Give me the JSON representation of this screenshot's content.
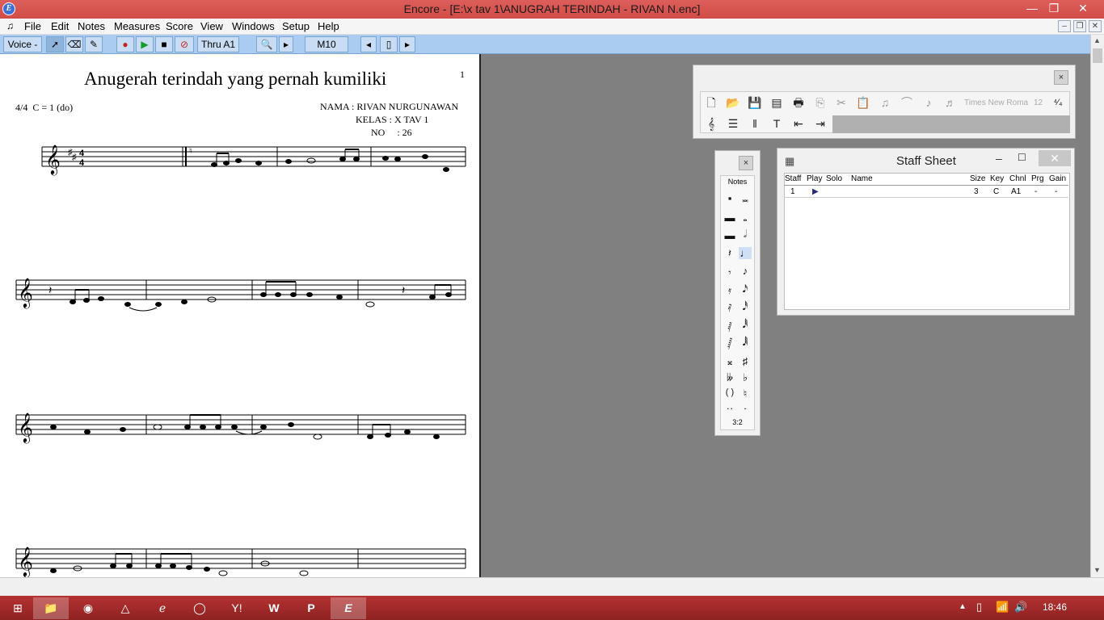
{
  "window": {
    "title": "Encore - [E:\\x tav 1\\ANUGRAH TERINDAH - RIVAN N.enc]",
    "minimize": "—",
    "restore": "❐",
    "close": "✕"
  },
  "menu": {
    "items": [
      "File",
      "Edit",
      "Notes",
      "Measures",
      "Score",
      "View",
      "Windows",
      "Setup",
      "Help"
    ],
    "mdi_min": "–",
    "mdi_restore": "❐",
    "mdi_close": "✕"
  },
  "toolbar": {
    "voice": "Voice -",
    "thru": "Thru A1",
    "measure": "M10"
  },
  "score": {
    "title": "Anugerah terindah yang pernah kumiliki",
    "page_number": "1",
    "meter": "4/4  C = 1 (do)",
    "name": "NAMA : RIVAN NURGUNAWAN",
    "class": "KELAS : X TAV 1",
    "number": "NO     : 26"
  },
  "toolbar_panel": {
    "font": "Times New Roma",
    "size": "12"
  },
  "notes_palette": {
    "title": "Notes",
    "tuplet": "3:2"
  },
  "staff_sheet": {
    "title": "Staff Sheet",
    "headers": [
      "Staff",
      "Play",
      "Solo",
      "Name",
      "Size",
      "Key",
      "Chnl",
      "Prg",
      "Gain"
    ],
    "row": {
      "staff": "1",
      "play": "▶",
      "solo": "",
      "name": "",
      "size": "3",
      "key": "C",
      "chnl": "A1",
      "prg": "-",
      "gain": "-"
    }
  },
  "taskbar": {
    "clock": "18:46"
  },
  "icons": [
    "app-logo-icon",
    "start-icon",
    "explorer-icon",
    "firefox-icon",
    "avast-icon",
    "ie-icon",
    "opera-icon",
    "yahoo-icon",
    "word-icon",
    "powerpoint-icon",
    "encore-icon"
  ]
}
